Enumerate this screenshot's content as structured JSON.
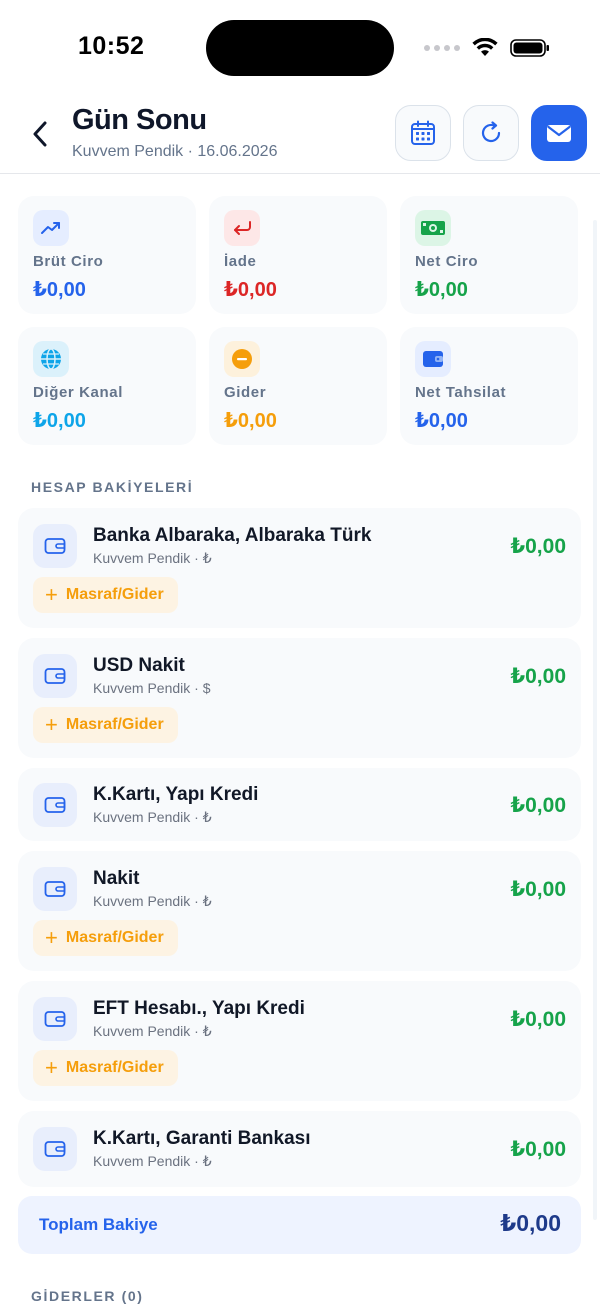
{
  "status": {
    "time": "10:52"
  },
  "header": {
    "title": "Gün Sonu",
    "subtitle": "Kuvvem Pendik · 16.06.2026"
  },
  "colors": {
    "primary": "#2563eb",
    "positive": "#16a34a",
    "negative": "#dc2626",
    "warning": "#f59e0b",
    "cyan": "#0ea5e9"
  },
  "summary": [
    {
      "label": "Brüt Ciro",
      "value": "₺0,00",
      "icon": "trending-up-icon",
      "color": "#2563eb"
    },
    {
      "label": "İade",
      "value": "₺0,00",
      "icon": "return-arrow-icon",
      "color": "#dc2626"
    },
    {
      "label": "Net Ciro",
      "value": "₺0,00",
      "icon": "banknote-icon",
      "color": "#16a34a"
    },
    {
      "label": "Diğer Kanal",
      "value": "₺0,00",
      "icon": "globe-icon",
      "color": "#0ea5e9"
    },
    {
      "label": "Gider",
      "value": "₺0,00",
      "icon": "minus-circle-icon",
      "color": "#f59e0b"
    },
    {
      "label": "Net Tahsilat",
      "value": "₺0,00",
      "icon": "wallet-icon",
      "color": "#2563eb"
    }
  ],
  "accounts_section": {
    "title": "HESAP BAKİYELERİ"
  },
  "expense_button_label": "Masraf/Gider",
  "accounts": [
    {
      "name": "Banka Albaraka, Albaraka Türk",
      "sub": "Kuvvem Pendik · ₺",
      "balance": "₺0,00",
      "has_expense": true
    },
    {
      "name": "USD Nakit",
      "sub": "Kuvvem Pendik · $",
      "balance": "₺0,00",
      "has_expense": true
    },
    {
      "name": "K.Kartı, Yapı Kredi",
      "sub": "Kuvvem Pendik · ₺",
      "balance": "₺0,00",
      "has_expense": false
    },
    {
      "name": "Nakit",
      "sub": "Kuvvem Pendik · ₺",
      "balance": "₺0,00",
      "has_expense": true
    },
    {
      "name": "EFT Hesabı., Yapı Kredi",
      "sub": "Kuvvem Pendik · ₺",
      "balance": "₺0,00",
      "has_expense": true
    },
    {
      "name": "K.Kartı, Garanti Bankası",
      "sub": "Kuvvem Pendik · ₺",
      "balance": "₺0,00",
      "has_expense": false
    }
  ],
  "total": {
    "label": "Toplam Bakiye",
    "value": "₺0,00"
  },
  "expenses_section": {
    "title": "GİDERLER (0)"
  }
}
